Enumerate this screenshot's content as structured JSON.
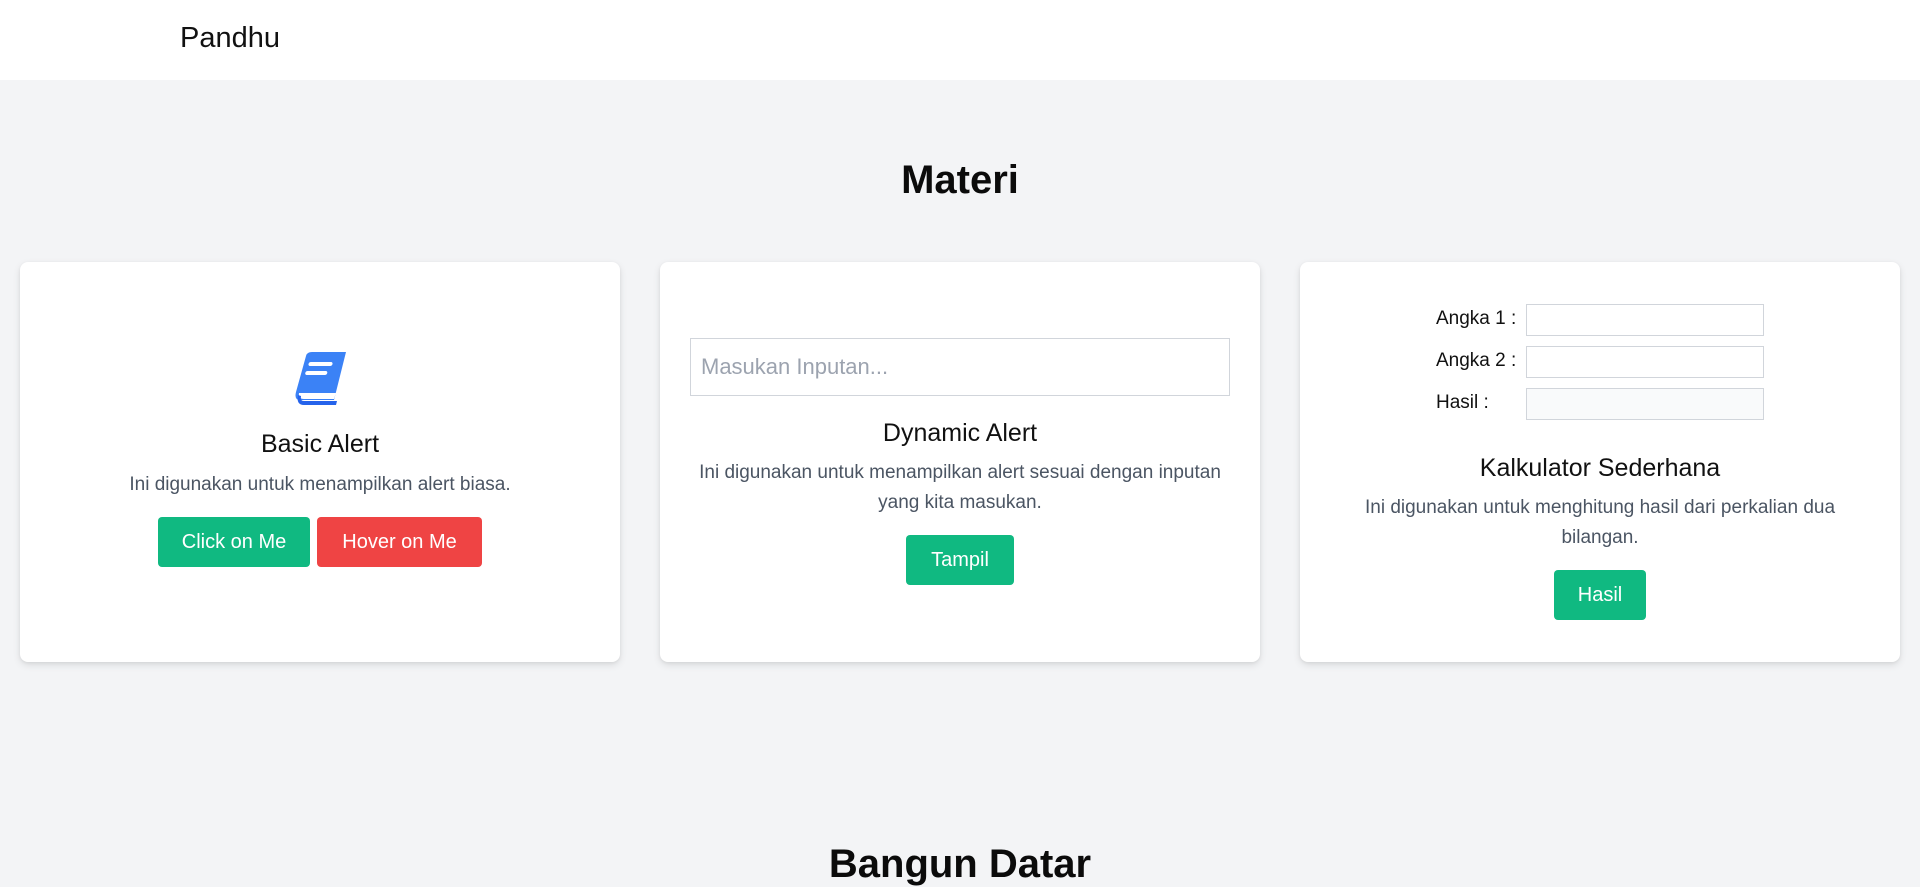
{
  "header": {
    "brand": "Pandhu"
  },
  "sections": {
    "materi_title": "Materi",
    "bangun_datar_title": "Bangun Datar"
  },
  "cards": {
    "basic": {
      "icon": "book-icon",
      "title": "Basic Alert",
      "description": "Ini digunakan untuk menampilkan alert biasa.",
      "click_label": "Click on Me",
      "hover_label": "Hover on Me"
    },
    "dynamic": {
      "input_placeholder": "Masukan Inputan...",
      "input_value": "",
      "title": "Dynamic Alert",
      "description": "Ini digunakan untuk menampilkan alert sesuai dengan inputan yang kita masukan.",
      "button_label": "Tampil"
    },
    "calculator": {
      "angka1_label": "Angka 1 :",
      "angka2_label": "Angka 2 :",
      "hasil_label": "Hasil :",
      "angka1_value": "",
      "angka2_value": "",
      "hasil_value": "",
      "title": "Kalkulator Sederhana",
      "description": "Ini digunakan untuk menghitung hasil dari perkalian dua bilangan.",
      "button_label": "Hasil"
    }
  },
  "colors": {
    "background": "#f3f4f6",
    "primary_button": "#10b981",
    "danger_button": "#ef4444",
    "icon_blue": "#3b82f6"
  }
}
